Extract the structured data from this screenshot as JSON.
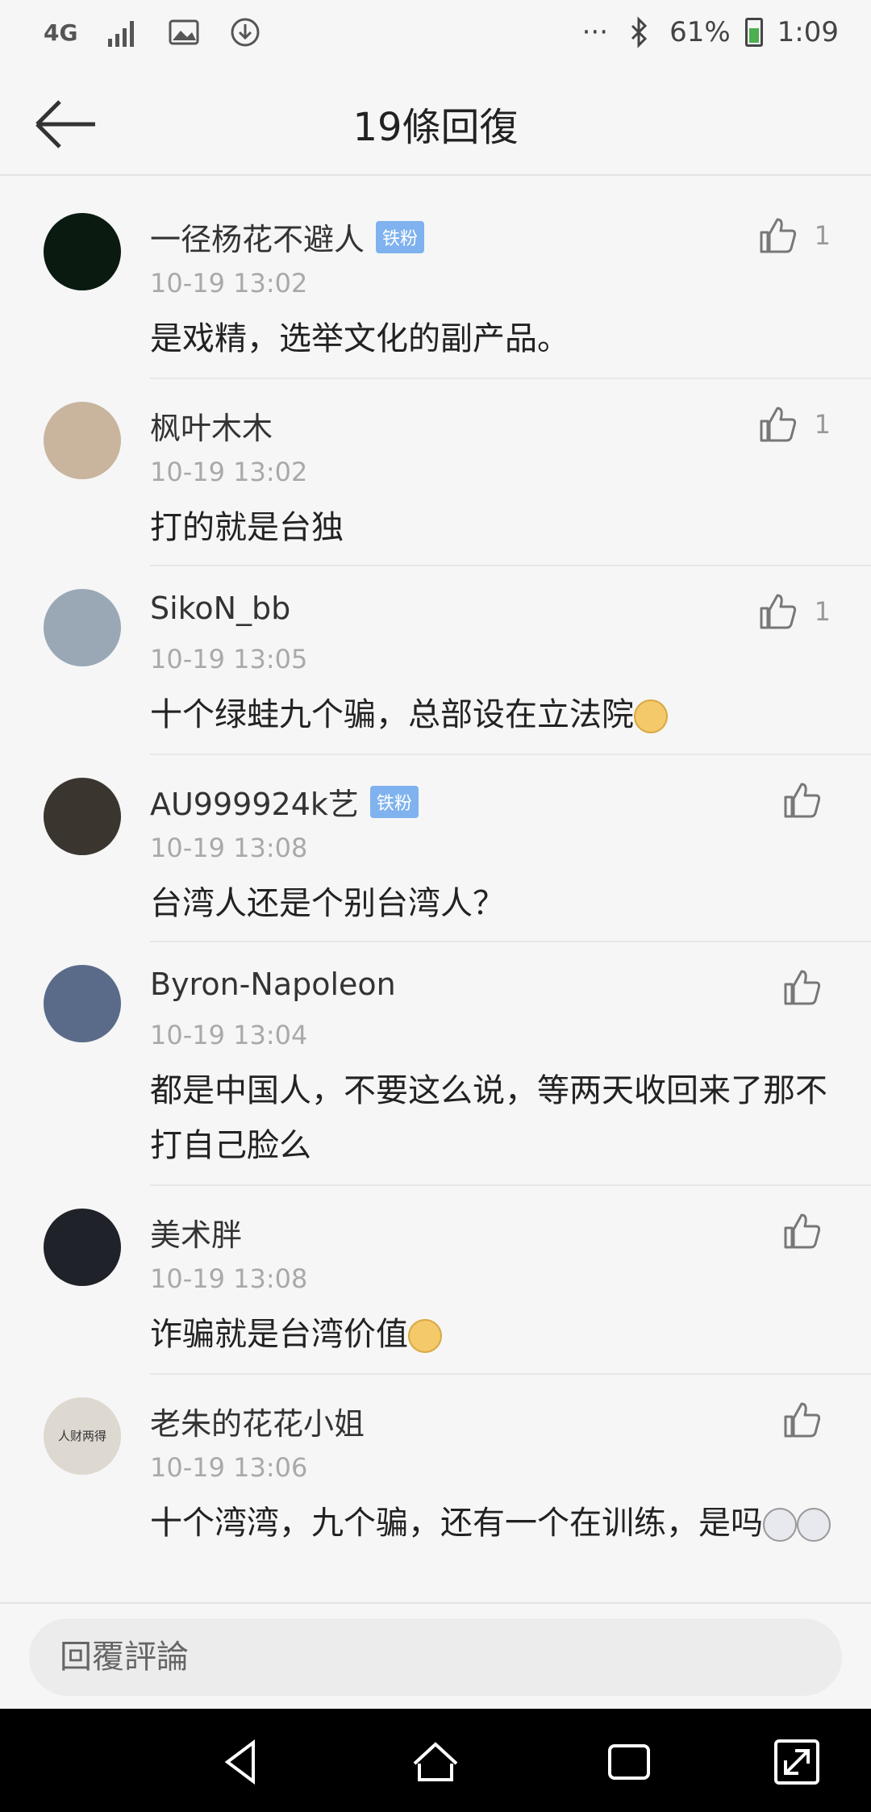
{
  "status_bar": {
    "network": "4G",
    "dots": "···",
    "battery": "61%",
    "time": "1:09"
  },
  "header": {
    "title": "19條回復"
  },
  "comments": [
    {
      "name": "一径杨花不避人",
      "badge": "铁粉",
      "time": "10-19 13:02",
      "text": "是戏精，选举文化的副产品。",
      "likes": "1",
      "emojis": [],
      "avatar_color": "#0a1a10"
    },
    {
      "name": "枫叶木木",
      "badge": "",
      "time": "10-19 13:02",
      "text": "打的就是台独",
      "likes": "1",
      "emojis": [],
      "avatar_color": "#c9b49e"
    },
    {
      "name": "SikoN_bb",
      "badge": "",
      "time": "10-19 13:05",
      "text": "十个绿蛙九个骗，总部设在立法院",
      "likes": "1",
      "emojis": [
        "doge"
      ],
      "avatar_color": "#9aa8b5"
    },
    {
      "name": "AU999924k艺",
      "badge": "铁粉",
      "time": "10-19 13:08",
      "text": "台湾人还是个别台湾人？",
      "likes": "",
      "emojis": [],
      "avatar_color": "#3b3530"
    },
    {
      "name": "Byron-Napoleon",
      "badge": "",
      "time": "10-19 13:04",
      "text": "都是中国人，不要这么说，等两天收回来了那不打自己脸么",
      "likes": "",
      "emojis": [],
      "avatar_color": "#5a6b8a"
    },
    {
      "name": "美术胖",
      "badge": "",
      "time": "10-19 13:08",
      "text": "诈骗就是台湾价值",
      "likes": "",
      "emojis": [
        "doge"
      ],
      "avatar_color": "#1f2228"
    },
    {
      "name": "老朱的花花小姐",
      "badge": "",
      "time": "10-19 13:06",
      "text": "十个湾湾，九个骗，还有一个在训练，是吗",
      "likes": "",
      "emojis": [
        "husky",
        "husky"
      ],
      "avatar_color": "#ddd8d0",
      "avatar_text": "人财两得"
    }
  ],
  "reply": {
    "placeholder": "回覆評論"
  }
}
